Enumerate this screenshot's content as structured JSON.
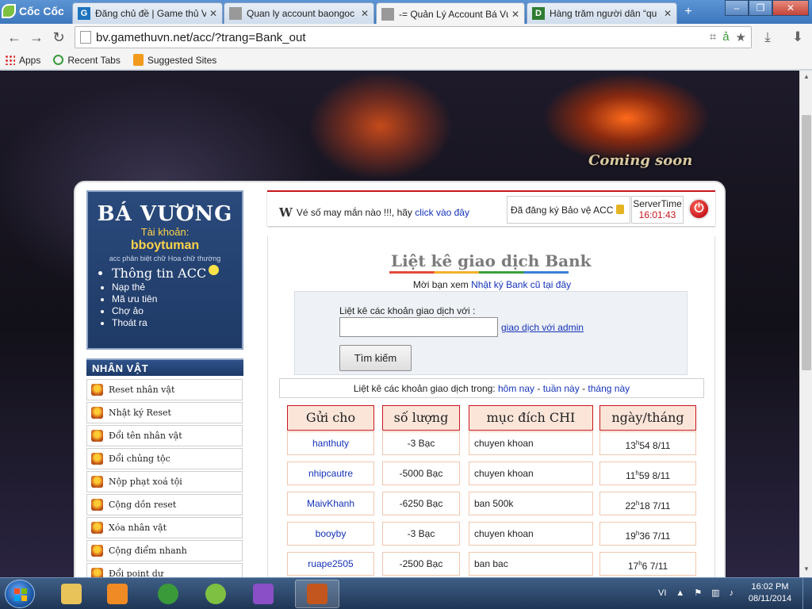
{
  "browser": {
    "logo_text": "Cốc Cốc",
    "tabs": [
      {
        "title": "Đăng chủ đề | Game thủ V",
        "favicon": "G",
        "color": "#1e73be"
      },
      {
        "title": "Quan ly account baongoc",
        "favicon": "",
        "color": "#999999"
      },
      {
        "title": "-= Quản Lý Account Bá Vương",
        "favicon": "",
        "color": "#999999",
        "active": true
      },
      {
        "title": "Hàng trăm người dân “qu",
        "favicon": "D",
        "color": "#2e7d32"
      }
    ],
    "url": "bv.gamethuvn.net/acc/?trang=Bank_out",
    "bookmarks": [
      {
        "label": "Apps",
        "icon": "apps-grid-icon"
      },
      {
        "label": "Recent Tabs",
        "icon": "recent-tabs-icon"
      },
      {
        "label": "Suggested Sites",
        "icon": "suggested-sites-icon"
      }
    ]
  },
  "banner": {
    "coming_soon": "Coming soon"
  },
  "user_panel": {
    "brand": "BÁ VƯƠNG",
    "account_label": "Tài khoản:",
    "account_name": "bboytuman",
    "account_note": "acc phân biệt chữ Hoa chữ thường",
    "menu": [
      {
        "label": "Thông tin ACC",
        "big": true
      },
      {
        "label": "Nạp thẻ"
      },
      {
        "label": "Mã ưu tiên"
      },
      {
        "label": "Chợ ảo"
      },
      {
        "label": "Thoát ra"
      }
    ]
  },
  "character_menu": {
    "title": "NHÂN VẬT",
    "items": [
      "Reset nhân vật",
      "Nhật ký Reset",
      "Đổi tên nhân vật",
      "Đổi chủng tộc",
      "Nộp phạt xoá tội",
      "Cộng dồn reset",
      "Xóa nhân vật",
      "Cộng điểm nhanh",
      "Đổi point dư"
    ]
  },
  "topbar": {
    "logo": "W",
    "lottery_text": "Vé số may mắn nào !!!, hãy",
    "lottery_link": "click vào đây",
    "protect_text": "Đã đăng ký Bảo vệ ACC",
    "server_label": "ServerTime",
    "server_time": "16:01:43"
  },
  "main": {
    "title": "Liệt kê giao dịch Bank",
    "subtitle_prefix": "Mời bạn xem",
    "subtitle_link": "Nhật ký Bank cũ tại đây",
    "search_label": "Liệt kê các khoản giao dịch với :",
    "search_value": "",
    "admin_link": "giao dịch với admin",
    "search_button": "Tìm kiếm",
    "filter_prefix": "Liệt kê các khoản giao dịch trong:",
    "filters": [
      "hôm nay",
      "tuần này",
      "tháng này"
    ],
    "filter_sep": " - ",
    "columns": [
      "Gửi cho",
      "số lượng",
      "mục đích CHI",
      "ngày/tháng"
    ],
    "rows": [
      {
        "to": "hanthuty",
        "amount": "-3  Bạc",
        "purpose": "chuyen khoan",
        "hour": "13",
        "min": "54",
        "date": "8/11"
      },
      {
        "to": "nhipcautre",
        "amount": "-5000  Bạc",
        "purpose": "chuyen khoan",
        "hour": "11",
        "min": "59",
        "date": "8/11"
      },
      {
        "to": "MaivKhanh",
        "amount": "-6250  Bạc",
        "purpose": "ban 500k",
        "hour": "22",
        "min": "18",
        "date": "7/11"
      },
      {
        "to": "booyby",
        "amount": "-3  Bạc",
        "purpose": "chuyen khoan",
        "hour": "19",
        "min": "36",
        "date": "7/11"
      },
      {
        "to": "ruape2505",
        "amount": "-2500  Bạc",
        "purpose": "ban bac",
        "hour": "17",
        "min": "6",
        "date": "7/11"
      }
    ]
  },
  "taskbar": {
    "lang": "VI",
    "time": "16:02 PM",
    "date": "08/11/2014",
    "apps": [
      {
        "name": "explorer",
        "color": "#e8c35a"
      },
      {
        "name": "media-player",
        "color": "#f08a24"
      },
      {
        "name": "chrome",
        "color": "#3a9a3a"
      },
      {
        "name": "coccoc",
        "color": "#7ec142"
      },
      {
        "name": "yahoo-messenger",
        "color": "#8a4fc6"
      },
      {
        "name": "game",
        "color": "#c2561e"
      }
    ]
  }
}
